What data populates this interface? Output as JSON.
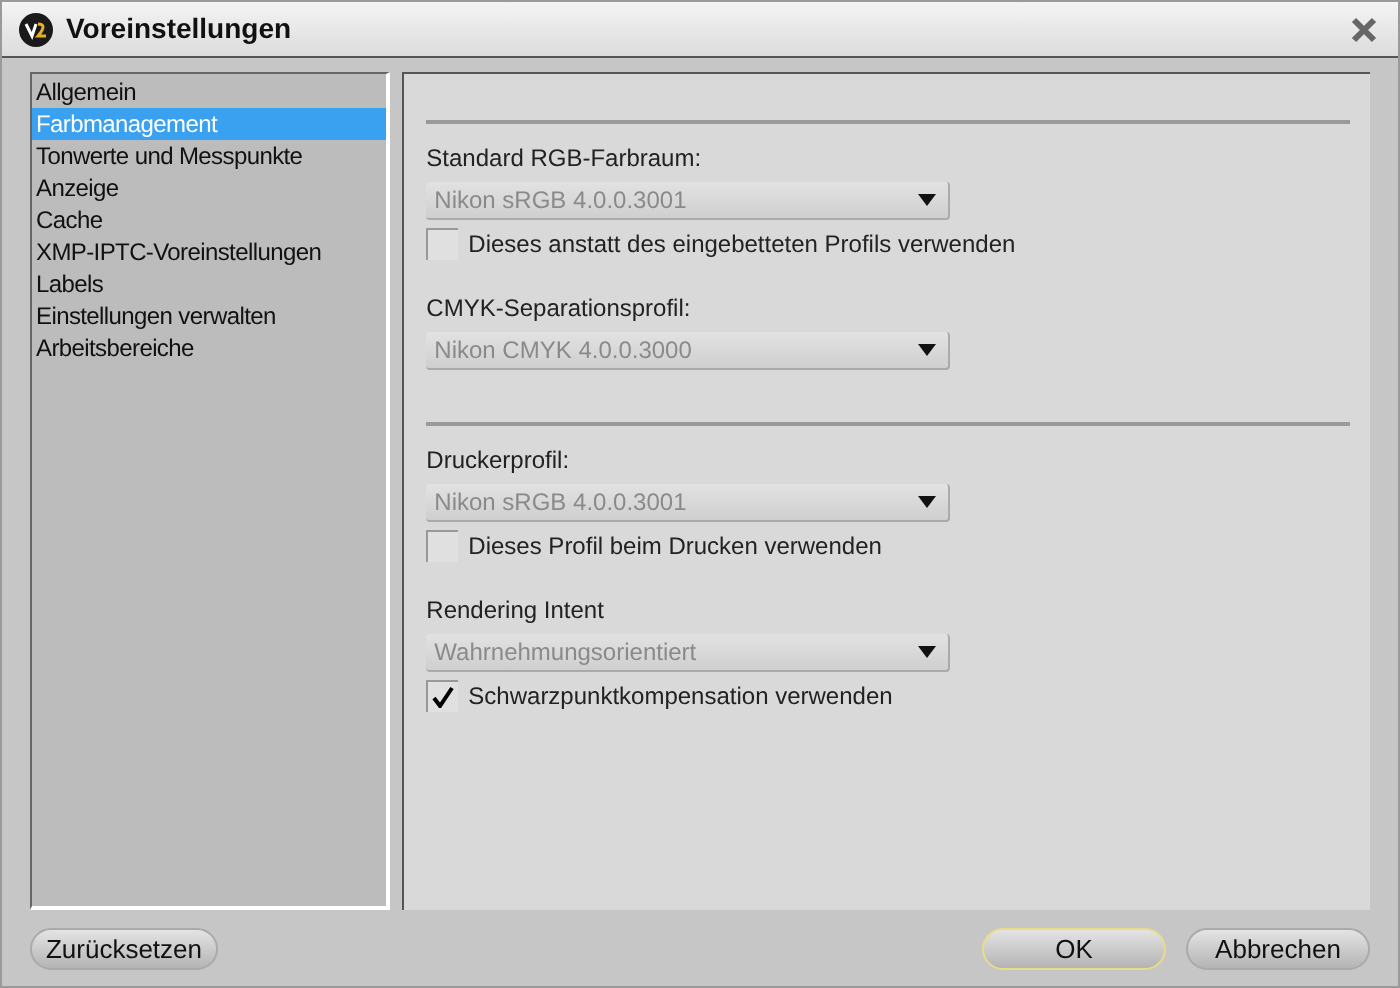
{
  "window": {
    "title": "Voreinstellungen"
  },
  "sidebar": {
    "items": [
      {
        "label": "Allgemein",
        "selected": false
      },
      {
        "label": "Farbmanagement",
        "selected": true
      },
      {
        "label": "Tonwerte und Messpunkte",
        "selected": false
      },
      {
        "label": "Anzeige",
        "selected": false
      },
      {
        "label": "Cache",
        "selected": false
      },
      {
        "label": "XMP-IPTC-Voreinstellungen",
        "selected": false
      },
      {
        "label": "Labels",
        "selected": false
      },
      {
        "label": "Einstellungen verwalten",
        "selected": false
      },
      {
        "label": "Arbeitsbereiche",
        "selected": false
      }
    ]
  },
  "sections": [
    {
      "items": [
        {
          "kind": "label",
          "text": "Standard RGB-Farbraum:"
        },
        {
          "kind": "dropdown",
          "value": "Nikon sRGB 4.0.0.3001",
          "disabled": true
        },
        {
          "kind": "checkbox",
          "label": "Dieses anstatt des eingebetteten Profils verwenden",
          "checked": false
        },
        {
          "kind": "spacer"
        },
        {
          "kind": "label",
          "text": "CMYK-Separationsprofil:"
        },
        {
          "kind": "dropdown",
          "value": "Nikon CMYK 4.0.0.3000",
          "disabled": true
        }
      ]
    },
    {
      "items": [
        {
          "kind": "label",
          "text": "Druckerprofil:"
        },
        {
          "kind": "dropdown",
          "value": "Nikon sRGB 4.0.0.3001",
          "disabled": true
        },
        {
          "kind": "checkbox",
          "label": "Dieses Profil beim Drucken verwenden",
          "checked": false
        },
        {
          "kind": "spacer"
        },
        {
          "kind": "label",
          "text": "Rendering Intent"
        },
        {
          "kind": "dropdown",
          "value": "Wahrnehmungsorientiert",
          "disabled": true
        },
        {
          "kind": "checkbox",
          "label": "Schwarzpunktkompensation verwenden",
          "checked": true
        }
      ]
    }
  ],
  "buttons": [
    {
      "label": "Zurücksetzen",
      "default": false
    },
    {
      "label": "OK",
      "default": true
    },
    {
      "label": "Abbrechen",
      "default": false
    }
  ]
}
